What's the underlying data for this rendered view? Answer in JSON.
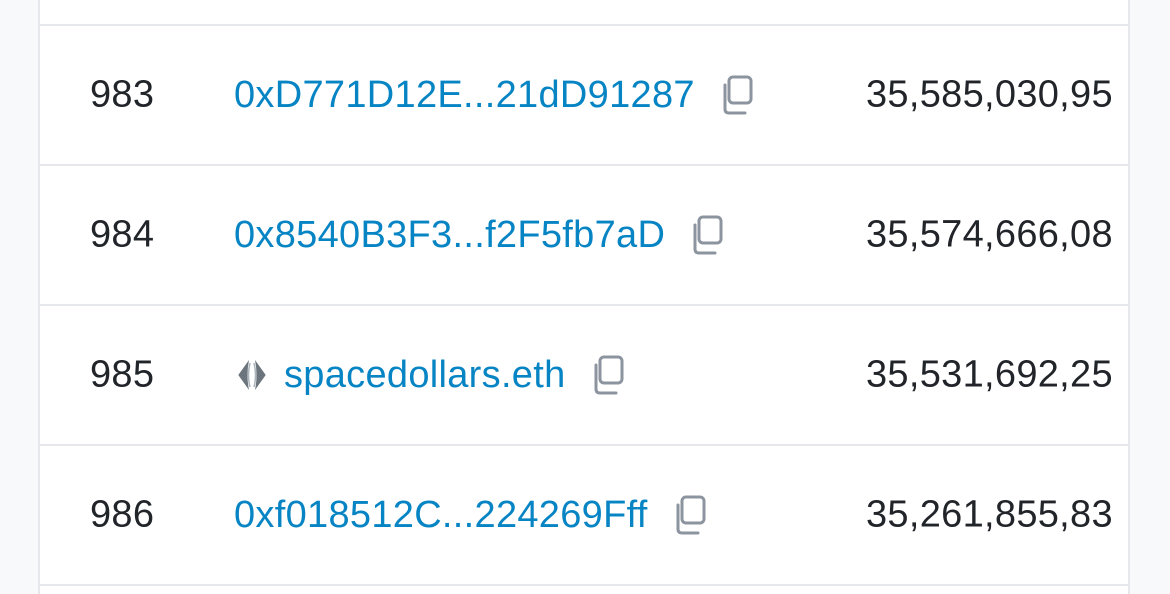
{
  "table": {
    "rows": [
      {
        "rank": "983",
        "address": "0xD771D12E...21dD91287",
        "has_ens_icon": false,
        "quantity": "35,585,030,95"
      },
      {
        "rank": "984",
        "address": "0x8540B3F3...f2F5fb7aD",
        "has_ens_icon": false,
        "quantity": "35,574,666,08"
      },
      {
        "rank": "985",
        "address": "spacedollars.eth",
        "has_ens_icon": true,
        "quantity": "35,531,692,25"
      },
      {
        "rank": "986",
        "address": "0xf018512C...224269Fff",
        "has_ens_icon": false,
        "quantity": "35,261,855,83"
      }
    ]
  },
  "colors": {
    "link": "#0784c3",
    "text": "#212529",
    "icon": "#8c959f",
    "border": "#e6e8eb",
    "background": "#f8f9fa"
  },
  "icons": {
    "copy": "copy-icon",
    "ens": "ens-icon"
  }
}
